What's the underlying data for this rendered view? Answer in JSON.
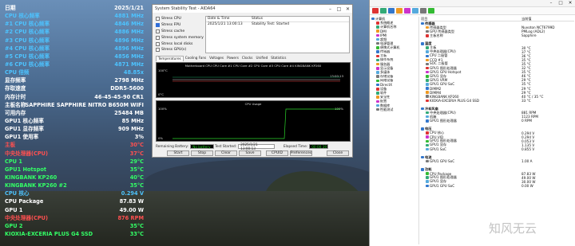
{
  "osd": {
    "rows": [
      {
        "label": "日期",
        "value": "2025/1/21",
        "color": "#ffffff",
        "cls": "date"
      },
      {
        "label": "CPU 核心频率",
        "value": "4881 MHz",
        "color": "#4dc3ff"
      },
      {
        "label": "#1 CPU 核心频率",
        "value": "4846 MHz",
        "color": "#4dc3ff"
      },
      {
        "label": "#2 CPU 核心频率",
        "value": "4886 MHz",
        "color": "#4dc3ff"
      },
      {
        "label": "#3 CPU 核心频率",
        "value": "4896 MHz",
        "color": "#4dc3ff"
      },
      {
        "label": "#4 CPU 核心频率",
        "value": "4896 MHz",
        "color": "#4dc3ff"
      },
      {
        "label": "#5 CPU 核心频率",
        "value": "4856 MHz",
        "color": "#4dc3ff"
      },
      {
        "label": "#6 CPU 核心频率",
        "value": "4871 MHz",
        "color": "#4dc3ff"
      },
      {
        "label": "CPU 倍频",
        "value": "48.85x",
        "color": "#4dc3ff"
      },
      {
        "label": "显存频率",
        "value": "2798 MHz",
        "color": "#ffffff"
      },
      {
        "label": "存取速度",
        "value": "DDR5-5600",
        "color": "#ffffff"
      },
      {
        "label": "内存计时",
        "value": "46-45-45-90 CR1",
        "color": "#ffffff"
      },
      {
        "label": "主板名称",
        "value": "SAPPHIRE SAPPHIRE NITRO B650M WIFI",
        "color": "#ffffff"
      },
      {
        "label": "可用内存",
        "value": "25484 MB",
        "color": "#ffffff"
      },
      {
        "label": "GPU1 核心频率",
        "value": "85 MHz",
        "color": "#ffffff"
      },
      {
        "label": "GPU1 显存频率",
        "value": "909 MHz",
        "color": "#ffffff"
      },
      {
        "label": "GPU1 使用率",
        "value": "3%",
        "color": "#ffffff"
      },
      {
        "label": "主板",
        "value": "30°C",
        "color": "#ff5050"
      },
      {
        "label": "中央处理器(CPU)",
        "value": "37°C",
        "color": "#ff5050"
      },
      {
        "label": "CPU 1",
        "value": "29°C",
        "color": "#33ff66"
      },
      {
        "label": "GPU1 Hotspot",
        "value": "35°C",
        "color": "#33ff66"
      },
      {
        "label": "KINGBANK KP260",
        "value": "40°C",
        "color": "#33ff66"
      },
      {
        "label": "KINGBANK KP260 #2",
        "value": "35°C",
        "color": "#33ff66"
      },
      {
        "label": "CPU 核心",
        "value": "0.294 V",
        "color": "#4dc3ff"
      },
      {
        "label": "CPU Package",
        "value": "87.83 W",
        "color": "#ffffff"
      },
      {
        "label": "GPU 1",
        "value": "49.00 W",
        "color": "#ffffff"
      },
      {
        "label": "中央处理器(CPU)",
        "value": "876 RPM",
        "color": "#ff5050"
      },
      {
        "label": "GPU 2",
        "value": "35°C",
        "color": "#33ff66"
      },
      {
        "label": "KIOXIA-EXCERIA PLUS G4 SSD",
        "value": "33°C",
        "color": "#33ff66"
      }
    ]
  },
  "stability": {
    "title": "System Stability Test - AIDA64",
    "options": [
      "Stress CPU",
      "Stress FPU",
      "Stress cache",
      "Stress system memory",
      "Stress local disks",
      "Stress GPU(s)"
    ],
    "options_checked": [
      false,
      true,
      false,
      false,
      false,
      false
    ],
    "log_headers": [
      "Date & Time",
      "Status"
    ],
    "log_rows": [
      {
        "time": "2025/1/21 13:00:13",
        "status": "Stability Test: Started"
      }
    ],
    "tabs": [
      "Temperatures",
      "Cooling Fans",
      "Voltages",
      "Powers",
      "Clocks",
      "Unified",
      "Statistics"
    ],
    "temp_graph": {
      "legend": "Motherboard   CPU   CPU Core #1   CPU Core #2   CPU Core #3   CPU Core #4   KINGBANK KP260",
      "top_label": "100°C",
      "bottom_label": "0°C",
      "right_label": "13:00:13"
    },
    "usage_graph": {
      "legend": "CPU Usage",
      "top_label": "100%",
      "bottom_label": "0%",
      "right_label": "100%"
    },
    "remaining_label": "Remaining Battery:",
    "remaining_value": "No battery",
    "started_label": "Test Started:",
    "started_value": "2025/1/21 13:00:13",
    "elapsed_label": "Elapsed Time:",
    "elapsed_value": "00:00:39",
    "buttons": [
      "Start",
      "Stop",
      "Clear",
      "Save",
      "CPUID",
      "Preferences",
      "Close"
    ]
  },
  "hw": {
    "tree": [
      "计算机",
      "系统概述",
      "计算机名称",
      "DMI",
      "IPMI",
      "超频",
      "电源管理",
      "便携式计算机",
      "传感器",
      "主板",
      "操作系统",
      "服务器",
      "显示设备",
      "多媒体",
      "存储设备",
      "网络设备",
      "DirectX",
      "设备",
      "软件",
      "安全性",
      "配置",
      "数据库",
      "性能测试"
    ],
    "headers": [
      "项目",
      "当前值"
    ],
    "rows": [
      {
        "name": "传感器",
        "value": "",
        "sect": true
      },
      {
        "name": "传感器类型",
        "value": "Nuvoton NCT6799D",
        "sect": false
      },
      {
        "name": "GPU 传感器类型",
        "value": "PMLog (ADL2)",
        "sect": false
      },
      {
        "name": "主板名称",
        "value": "Sapphire",
        "sect": false
      },
      {
        "name": "",
        "value": "",
        "sect": false
      },
      {
        "name": "温度",
        "value": "",
        "sect": true
      },
      {
        "name": "主板",
        "value": "30 °C",
        "sect": false
      },
      {
        "name": "中央处理器(CPU)",
        "value": "37 °C",
        "sect": false
      },
      {
        "name": "CPU 二极管",
        "value": "36 °C",
        "sect": false
      },
      {
        "name": "CCD #1",
        "value": "35 °C",
        "sect": false
      },
      {
        "name": "SOC 二极管",
        "value": "35 °C",
        "sect": false
      },
      {
        "name": "GPU1 图形处理器",
        "value": "32 °C",
        "sect": false
      },
      {
        "name": "GPU1 GPU Hotspot",
        "value": "35 °C",
        "sect": false
      },
      {
        "name": "GPU1 显存",
        "value": "46 °C",
        "sect": false
      },
      {
        "name": "GPU1 VRM",
        "value": "29 °C",
        "sect": false
      },
      {
        "name": "GPU1 GPU SoC",
        "value": "35 °C",
        "sect": false
      },
      {
        "name": "DIMM2",
        "value": "29 °C",
        "sect": false
      },
      {
        "name": "DIMM4",
        "value": "29 °C",
        "sect": false
      },
      {
        "name": "KINGBANK KP260",
        "value": "40 °C / 35 °C",
        "sect": false
      },
      {
        "name": "KIOXIA-EXCERIA PLUS G4 SSD",
        "value": "33 °C",
        "sect": false
      },
      {
        "name": "",
        "value": "",
        "sect": false
      },
      {
        "name": "冷却风扇",
        "value": "",
        "sect": true
      },
      {
        "name": "中央处理器(CPU)",
        "value": "881 RPM",
        "sect": false
      },
      {
        "name": "机箱",
        "value": "1123 RPM",
        "sect": false
      },
      {
        "name": "GPU1 图形处理器",
        "value": "0 RPM",
        "sect": false
      },
      {
        "name": "",
        "value": "",
        "sect": false
      },
      {
        "name": "电压",
        "value": "",
        "sect": true
      },
      {
        "name": "CPU 核心",
        "value": "0.294 V",
        "sect": false
      },
      {
        "name": "CPU VID",
        "value": "0.294 V",
        "sect": false
      },
      {
        "name": "GPU1 图形处理器",
        "value": "0.053 V",
        "sect": false
      },
      {
        "name": "GPU1 显存",
        "value": "1.135 V",
        "sect": false
      },
      {
        "name": "GPU1 SoC",
        "value": "0.855 V",
        "sect": false
      },
      {
        "name": "",
        "value": "",
        "sect": false
      },
      {
        "name": "电流",
        "value": "",
        "sect": true
      },
      {
        "name": "GPU1 GPU SoC",
        "value": "1.00 A",
        "sect": false
      },
      {
        "name": "",
        "value": "",
        "sect": false
      },
      {
        "name": "功耗",
        "value": "",
        "sect": true
      },
      {
        "name": "CPU Package",
        "value": "87.83 W",
        "sect": false
      },
      {
        "name": "GPU1 图形处理器",
        "value": "49.00 W",
        "sect": false
      },
      {
        "name": "GPU1 显存",
        "value": "30.00 W",
        "sect": false
      },
      {
        "name": "GPU1 GPU SoC",
        "value": "0.00 W",
        "sect": false
      }
    ]
  },
  "watermark": "知风无云"
}
